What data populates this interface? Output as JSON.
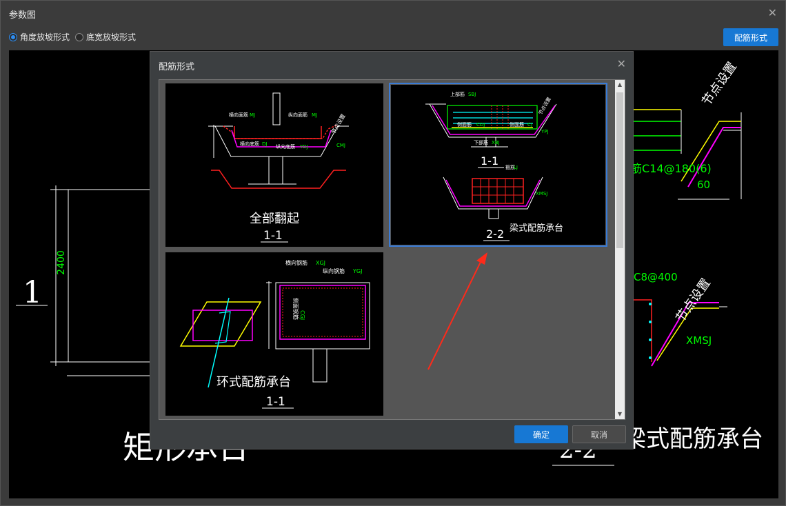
{
  "window": {
    "title": "参数图"
  },
  "radios": [
    {
      "label": "角度放坡形式",
      "selected": true
    },
    {
      "label": "底宽放坡形式",
      "selected": false
    }
  ],
  "toolbar": {
    "rebar_form_button": "配筋形式"
  },
  "background": {
    "dim_2400": "2400",
    "label_1": "1",
    "title_left": "矩形承台",
    "node_setting_1": "节点设置",
    "node_setting_2": "节点设置",
    "rebar_c14": "筋C14@180(6)",
    "angle_60": "60",
    "rebar_c8": "C8@400",
    "xmsj": "XMSJ",
    "title_right": "梁式配筋承台",
    "section_22": "2-2"
  },
  "dialog": {
    "title": "配筋形式",
    "ok": "确定",
    "cancel": "取消",
    "options": [
      {
        "name": "全部翻起",
        "section": "1-1",
        "selected": false,
        "labels": {
          "a": "横向面筋",
          "a_code": "MJ",
          "b": "纵向面筋",
          "b_code": "MJ",
          "c": "横向底筋",
          "c_code": "DJ",
          "d": "纵向底筋",
          "d_code": "YDJ",
          "e": "节点设置",
          "f": "CMJ"
        }
      },
      {
        "name": "梁式配筋承台",
        "section_top": "1-1",
        "section_bottom": "2-2",
        "selected": true,
        "labels": {
          "a": "上部筋",
          "a_code": "SBJ",
          "b": "侧面筋",
          "b_code": "CDJ",
          "c": "侧面筋",
          "c_code": "CJ",
          "d": "下部筋",
          "d_code": "XBJ",
          "e": "箍筋",
          "e_code": "LJ",
          "f": "节点设置",
          "g": "YPJ",
          "h": "XMSJ"
        }
      },
      {
        "name": "环式配筋承台",
        "section": "1-1",
        "selected": false,
        "labels": {
          "a": "横向钢筋",
          "a_code": "XGJ",
          "b": "纵向钢筋",
          "b_code": "YGJ",
          "c": "侧面钢筋",
          "c_code": "CGJ"
        }
      }
    ]
  },
  "colors": {
    "accent": "#1778d4",
    "cad_green": "#00ff00",
    "cad_magenta": "#ff00ff",
    "cad_red": "#ff2020",
    "cad_yellow": "#ffff00",
    "cad_cyan": "#00ffff"
  }
}
